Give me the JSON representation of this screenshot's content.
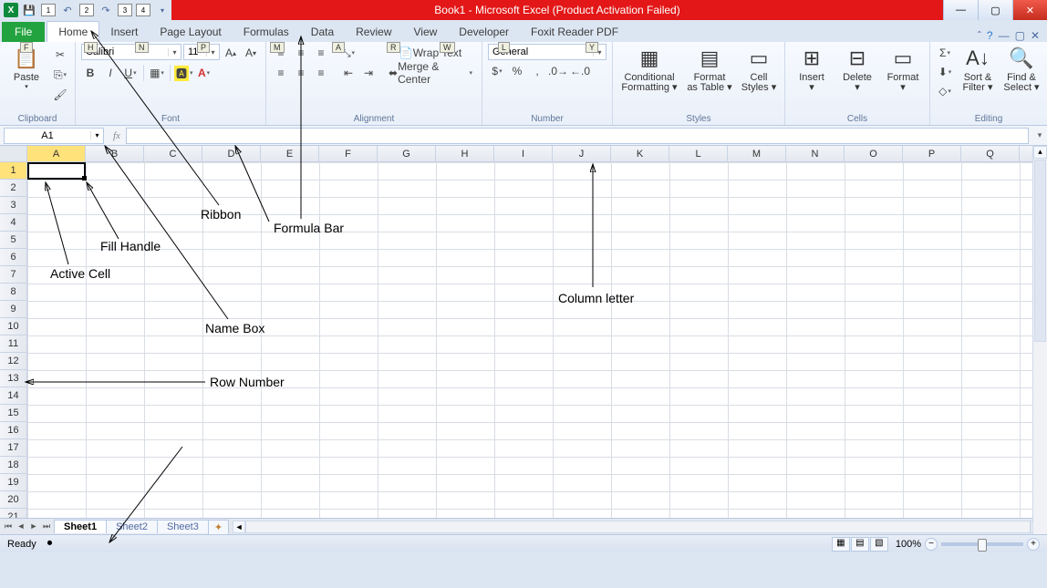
{
  "title": "Book1  -  Microsoft Excel (Product Activation Failed)",
  "qat_badges": [
    "1",
    "2",
    "3",
    "4"
  ],
  "tabs": {
    "file": "File",
    "home": "Home",
    "insert": "Insert",
    "pagelayout": "Page Layout",
    "formulas": "Formulas",
    "data": "Data",
    "review": "Review",
    "view": "View",
    "developer": "Developer",
    "foxit": "Foxit Reader PDF"
  },
  "keytips": {
    "file": "F",
    "home": "H",
    "insert": "N",
    "pagelayout": "P",
    "formulas": "M",
    "data": "A",
    "review": "R",
    "view": "W",
    "developer": "L",
    "foxit": "Y"
  },
  "ribbon": {
    "clipboard": {
      "label": "Clipboard",
      "paste": "Paste"
    },
    "font": {
      "label": "Font",
      "name": "Calibri",
      "size": "11",
      "bold": "B",
      "italic": "I",
      "underline": "U"
    },
    "alignment": {
      "label": "Alignment",
      "wrap": "Wrap Text",
      "merge": "Merge & Center"
    },
    "number": {
      "label": "Number",
      "format": "General"
    },
    "styles": {
      "label": "Styles",
      "conditional_line1": "Conditional",
      "conditional_line2": "Formatting",
      "table_line1": "Format",
      "table_line2": "as Table",
      "cell_line1": "Cell",
      "cell_line2": "Styles"
    },
    "cells": {
      "label": "Cells",
      "insert": "Insert",
      "delete": "Delete",
      "format": "Format"
    },
    "editing": {
      "label": "Editing",
      "sort_line1": "Sort &",
      "sort_line2": "Filter",
      "find_line1": "Find &",
      "find_line2": "Select"
    }
  },
  "namebox": "A1",
  "fx": "fx",
  "columns": [
    "A",
    "B",
    "C",
    "D",
    "E",
    "F",
    "G",
    "H",
    "I",
    "J",
    "K",
    "L",
    "M",
    "N",
    "O",
    "P",
    "Q"
  ],
  "rows": [
    "1",
    "2",
    "3",
    "4",
    "5",
    "6",
    "7",
    "8",
    "9",
    "10",
    "11",
    "12",
    "13",
    "14",
    "15",
    "16",
    "17",
    "18",
    "19",
    "20",
    "21"
  ],
  "sheets": {
    "s1": "Sheet1",
    "s2": "Sheet2",
    "s3": "Sheet3"
  },
  "status": {
    "ready": "Ready",
    "zoom": "100%"
  },
  "annotations": {
    "ribbon": "Ribbon",
    "formula_bar": "Formula Bar",
    "fill_handle": "Fill Handle",
    "active_cell": "Active Cell",
    "name_box": "Name Box",
    "column_letter": "Column letter",
    "row_number": "Row Number"
  }
}
